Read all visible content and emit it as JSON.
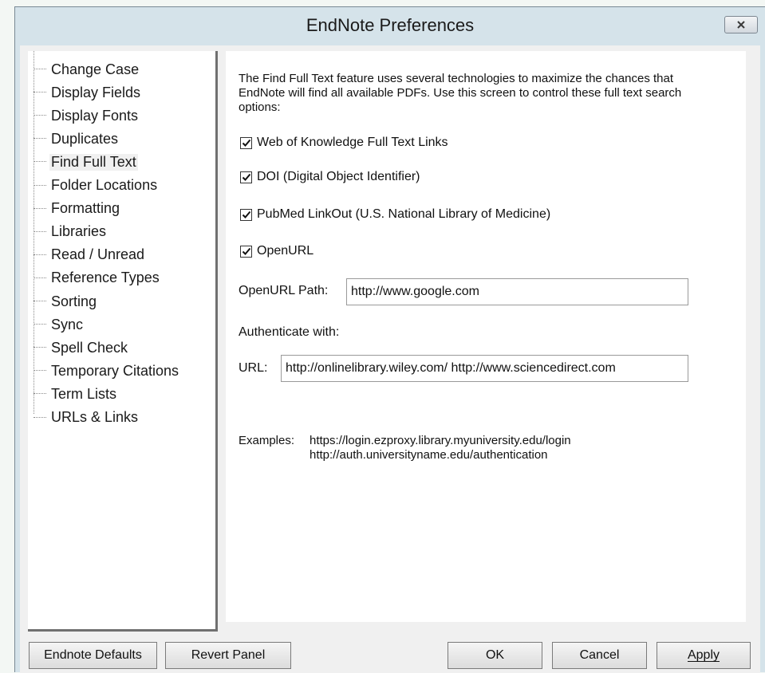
{
  "window": {
    "title": "EndNote Preferences",
    "close_icon": "close-x-icon"
  },
  "sidebar": {
    "selected": "Find Full Text",
    "items": [
      {
        "label": "Change Case"
      },
      {
        "label": "Display Fields"
      },
      {
        "label": "Display Fonts"
      },
      {
        "label": "Duplicates"
      },
      {
        "label": "Find Full Text"
      },
      {
        "label": "Folder Locations"
      },
      {
        "label": "Formatting"
      },
      {
        "label": "Libraries"
      },
      {
        "label": "Read / Unread"
      },
      {
        "label": "Reference Types"
      },
      {
        "label": "Sorting"
      },
      {
        "label": "Sync"
      },
      {
        "label": "Spell Check"
      },
      {
        "label": "Temporary Citations"
      },
      {
        "label": "Term Lists"
      },
      {
        "label": "URLs & Links"
      }
    ]
  },
  "panel": {
    "description": "The Find Full Text feature uses several technologies to maximize the chances that EndNote will find all available PDFs. Use this screen to control these full text search options:",
    "options": [
      {
        "label": "Web of Knowledge Full Text Links",
        "checked": true
      },
      {
        "label": "DOI (Digital Object Identifier)",
        "checked": true
      },
      {
        "label": "PubMed LinkOut (U.S. National Library of Medicine)",
        "checked": true
      },
      {
        "label": "OpenURL",
        "checked": true
      }
    ],
    "openurl_path_label": "OpenURL Path:",
    "openurl_path_value": "http://www.google.com",
    "authenticate_label": "Authenticate with:",
    "url_label": "URL:",
    "url_value": "http://onlinelibrary.wiley.com/ http://www.sciencedirect.com",
    "examples_label": "Examples:",
    "example_1": "https://login.ezproxy.library.myuniversity.edu/login",
    "example_2": "http://auth.universityname.edu/authentication"
  },
  "buttons": {
    "defaults": "Endnote Defaults",
    "revert": "Revert Panel",
    "ok": "OK",
    "cancel": "Cancel",
    "apply": "Apply"
  }
}
